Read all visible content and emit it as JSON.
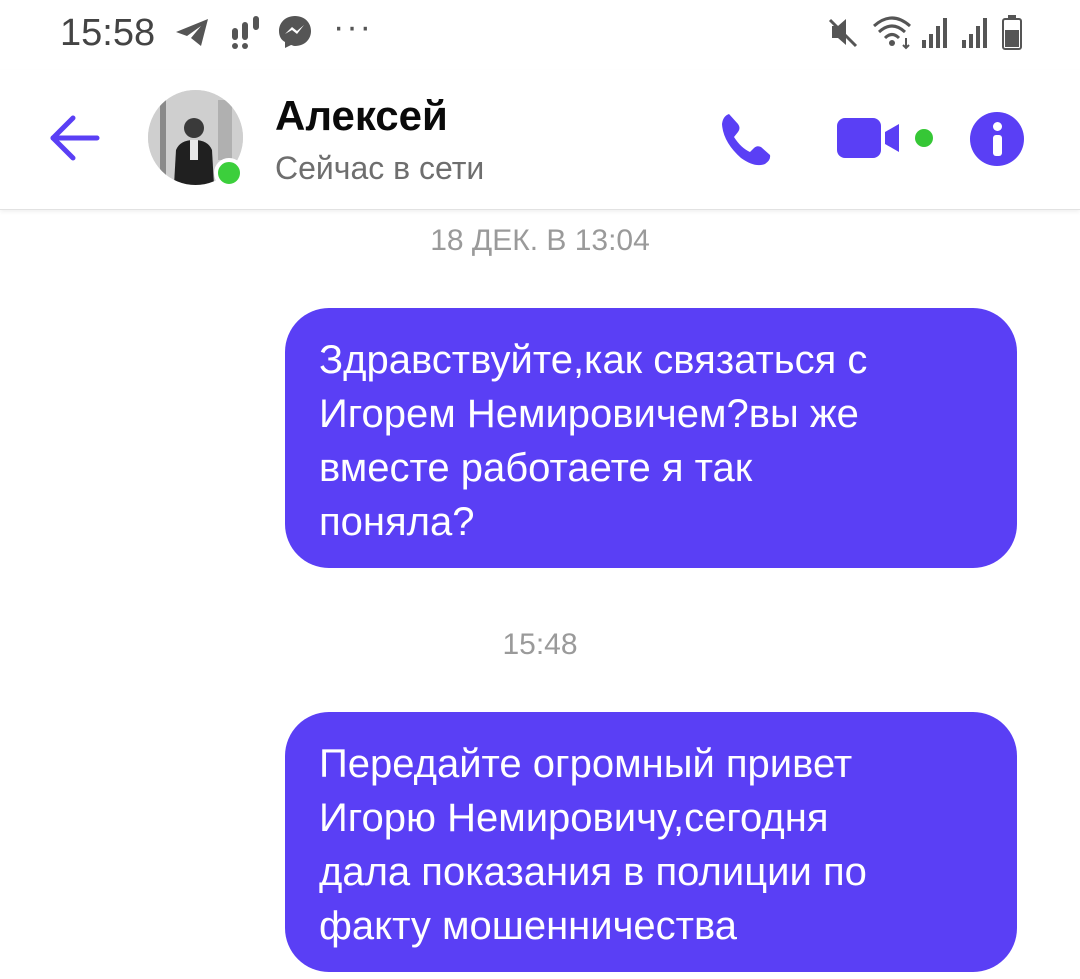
{
  "status_bar": {
    "time": "15:58",
    "dots": "···",
    "icons": [
      "telegram-icon",
      "notification-icon",
      "messenger-icon",
      "mute-icon",
      "wifi-icon",
      "signal-icon",
      "signal-icon-2",
      "battery-icon"
    ]
  },
  "header": {
    "contact_name": "Алексей",
    "contact_status": "Сейчас в сети",
    "accent_color": "#5a3ff5",
    "online_color": "#3ccf3c"
  },
  "chat": {
    "timestamps": [
      "18 ДЕК. В 13:04",
      "15:48"
    ],
    "messages": [
      {
        "text": "Здравствуйте,как связаться с\nИгорем Немировичем?вы же\nвместе работаете я так\nпоняла?",
        "sender": "me"
      },
      {
        "text": "Передайте огромный привет\nИгорю Немировичу,сегодня\nдала показания в полиции по\nфакту мошенничества",
        "sender": "me"
      }
    ]
  }
}
